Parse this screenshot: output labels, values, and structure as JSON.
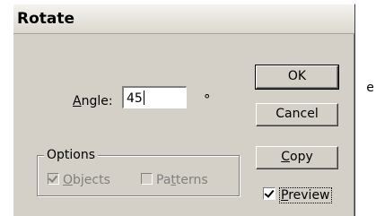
{
  "page": {
    "side_mark": "e"
  },
  "dialog": {
    "title": "Rotate",
    "angle": {
      "label": "Angle:",
      "mnemonic": "A",
      "rest": "ngle:",
      "value": "45",
      "unit": "°"
    },
    "options": {
      "legend": "Options",
      "objects": {
        "label": "Objects",
        "mnemonic": "O",
        "rest": "bjects",
        "checked": true,
        "enabled": false
      },
      "patterns": {
        "label": "Patterns",
        "pre": "Pa",
        "mnemonic": "t",
        "rest": "terns",
        "checked": false,
        "enabled": false
      }
    },
    "buttons": {
      "ok": "OK",
      "cancel": "Cancel",
      "copy": {
        "label": "Copy",
        "mnemonic": "C",
        "rest": "opy"
      }
    },
    "preview": {
      "label": "Preview",
      "mnemonic": "P",
      "rest": "review",
      "checked": true
    }
  }
}
